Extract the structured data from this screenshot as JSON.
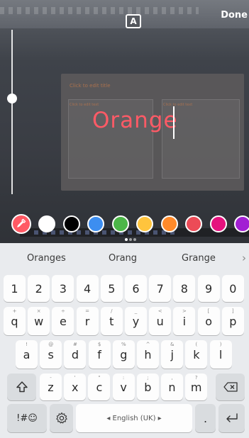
{
  "editor": {
    "text_style_label": "A",
    "done_label": "Done",
    "typed_text": "Orange",
    "text_color": "#ff5a66",
    "background_slide": {
      "title_placeholder": "Click to edit title",
      "box_left_label": "Click to edit text",
      "box_right_label": "Click to edit text"
    }
  },
  "palette": {
    "eyedropper_icon": "eyedropper-icon",
    "colors": [
      "#ffffff",
      "#000000",
      "#3d8ef0",
      "#4cb648",
      "#ffc43d",
      "#ff8a2a",
      "#ec4b57",
      "#e5127e",
      "#a21fd3"
    ]
  },
  "pager": {
    "pages": 3,
    "active": 0
  },
  "keyboard": {
    "suggestions": [
      "Oranges",
      "Orang",
      "Grange"
    ],
    "more_suggestions_icon": "chevron-right-icon",
    "number_row": [
      "1",
      "2",
      "3",
      "4",
      "5",
      "6",
      "7",
      "8",
      "9",
      "0"
    ],
    "row1": [
      {
        "key": "q",
        "hint": "+"
      },
      {
        "key": "w",
        "hint": "×"
      },
      {
        "key": "e",
        "hint": "÷"
      },
      {
        "key": "r",
        "hint": "="
      },
      {
        "key": "t",
        "hint": "/"
      },
      {
        "key": "y",
        "hint": "_"
      },
      {
        "key": "u",
        "hint": "<"
      },
      {
        "key": "i",
        "hint": ">"
      },
      {
        "key": "o",
        "hint": "["
      },
      {
        "key": "p",
        "hint": "]"
      }
    ],
    "row2": [
      {
        "key": "a",
        "hint": "!"
      },
      {
        "key": "s",
        "hint": "@"
      },
      {
        "key": "d",
        "hint": "#"
      },
      {
        "key": "f",
        "hint": "$"
      },
      {
        "key": "g",
        "hint": "%"
      },
      {
        "key": "h",
        "hint": "^"
      },
      {
        "key": "j",
        "hint": "&"
      },
      {
        "key": "k",
        "hint": "("
      },
      {
        "key": "l",
        "hint": ")"
      }
    ],
    "row3": [
      {
        "key": "z",
        "hint": "-"
      },
      {
        "key": "x",
        "hint": "'"
      },
      {
        "key": "c",
        "hint": "\""
      },
      {
        "key": "v",
        "hint": ":"
      },
      {
        "key": "b",
        "hint": ";"
      },
      {
        "key": "n",
        "hint": ","
      },
      {
        "key": "m",
        "hint": "?"
      }
    ],
    "symbols_label": "!#☺",
    "space_label": "◂  English (UK)  ▸",
    "period_label": ".",
    "shift_icon": "shift-icon",
    "backspace_icon": "backspace-icon",
    "settings_icon": "gear-icon",
    "enter_icon": "enter-icon"
  }
}
